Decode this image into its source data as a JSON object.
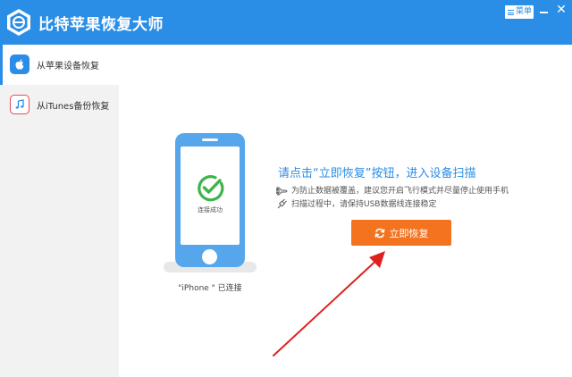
{
  "app": {
    "title": "比特苹果恢复大师"
  },
  "titlebar": {
    "menu_label": "菜单",
    "close_glyph": "✕"
  },
  "sidebar": {
    "items": [
      {
        "label": "从苹果设备恢复",
        "icon": "apple-icon",
        "active": true
      },
      {
        "label": "从iTunes备份恢复",
        "icon": "music-note-icon",
        "active": false
      }
    ]
  },
  "main": {
    "phone_status": "连接成功",
    "device_connected": "\"iPhone \" 已连接",
    "headline": "请点击“立即恢复”按钮，进入设备扫描",
    "tips": [
      {
        "icon": "airplane-icon",
        "text": "为防止数据被覆盖，建议您开启飞行模式并尽量停止使用手机"
      },
      {
        "icon": "plug-icon",
        "text": "扫描过程中，请保持USB数据线连接稳定"
      }
    ],
    "recover_button": "立即恢复"
  },
  "colors": {
    "brand_blue": "#2a8de6",
    "button_orange": "#f3731f",
    "success_green": "#3cb44a",
    "arrow_red": "#e02020"
  }
}
